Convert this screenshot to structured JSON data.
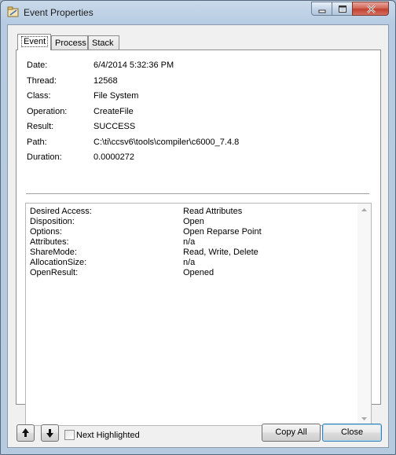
{
  "window": {
    "title": "Event Properties"
  },
  "tabs": [
    {
      "label": "Event"
    },
    {
      "label": "Process"
    },
    {
      "label": "Stack"
    }
  ],
  "event": {
    "date_label": "Date:",
    "date": "6/4/2014 5:32:36 PM",
    "thread_label": "Thread:",
    "thread": "12568",
    "class_label": "Class:",
    "class": "File System",
    "operation_label": "Operation:",
    "operation": "CreateFile",
    "result_label": "Result:",
    "result": "SUCCESS",
    "path_label": "Path:",
    "path": "C:\\ti\\ccsv6\\tools\\compiler\\c6000_7.4.8",
    "duration_label": "Duration:",
    "duration": "0.0000272"
  },
  "details": [
    {
      "name": "Desired Access:",
      "value": "Read Attributes"
    },
    {
      "name": "Disposition:",
      "value": "Open"
    },
    {
      "name": "Options:",
      "value": "Open Reparse Point"
    },
    {
      "name": "Attributes:",
      "value": "n/a"
    },
    {
      "name": "ShareMode:",
      "value": "Read, Write, Delete"
    },
    {
      "name": "AllocationSize:",
      "value": "n/a"
    },
    {
      "name": "OpenResult:",
      "value": "Opened"
    }
  ],
  "footer": {
    "next_highlighted_label": "Next Highlighted",
    "copy_all_label": "Copy All",
    "close_label": "Close",
    "prev_icon": "arrow-up-icon",
    "next_icon": "arrow-down-icon"
  },
  "colors": {
    "titlebar": "#b9cde2",
    "close_button": "#c9483a",
    "default_button_border": "#3c7fb1"
  }
}
